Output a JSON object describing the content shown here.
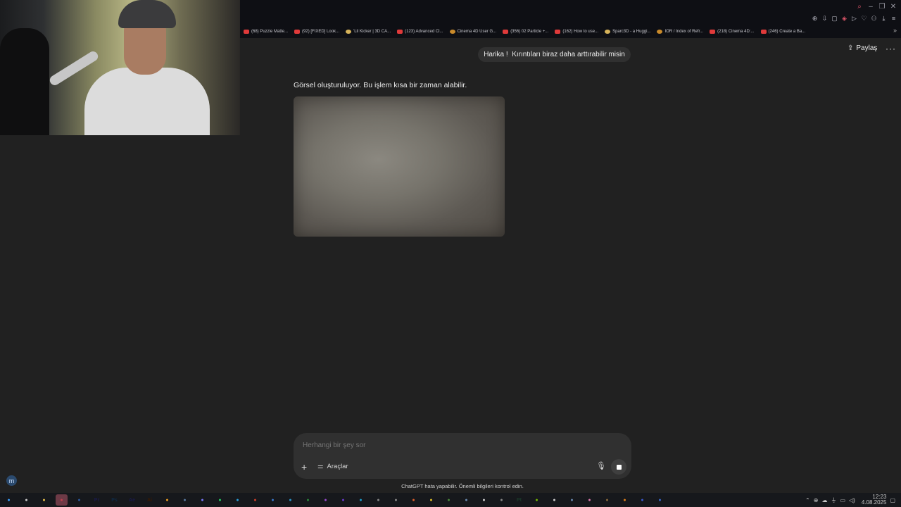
{
  "bookmarks": [
    {
      "label": "(68) Puzzle Matte...",
      "icon": "youtube-icon"
    },
    {
      "label": "(92) [FIXED] Look...",
      "icon": "youtube-icon"
    },
    {
      "label": "'Lil Kicker | 3D CA...",
      "icon": "cap-icon"
    },
    {
      "label": "(123) Advanced Cl...",
      "icon": "youtube-icon"
    },
    {
      "label": "Cinema 4D User G...",
      "icon": "gmail-icon"
    },
    {
      "label": "(356) 02 Particle +...",
      "icon": "youtube-icon"
    },
    {
      "label": "(162) How to use...",
      "icon": "youtube-icon"
    },
    {
      "label": "Sparc3D - a Huggi...",
      "icon": "huggingface-icon"
    },
    {
      "label": "IOR / Index of Refr...",
      "icon": "shield-icon"
    },
    {
      "label": "(218) Cinema 4D:...",
      "icon": "youtube-icon"
    },
    {
      "label": "(246) Create a Ba...",
      "icon": "youtube-icon"
    }
  ],
  "header": {
    "share_label": "Paylaş",
    "more_label": "···"
  },
  "conversation": {
    "user_message": "Harika !  Kırıntıları biraz daha arttırabilir misin",
    "assistant_status": "Görsel oluşturuluyor. Bu işlem kısa bir zaman alabilir."
  },
  "composer": {
    "placeholder": "Herhangi bir şey sor",
    "tools_label": "Araçlar"
  },
  "disclaimer": "ChatGPT hata yapabilir. Önemli bilgileri kontrol edin.",
  "avatar_letter": "m",
  "taskbar": {
    "apps": [
      {
        "label": "",
        "icon": "windows-start-icon",
        "color": "#3aa0ff"
      },
      {
        "label": "",
        "icon": "task-view-icon",
        "color": "#cfcfcf"
      },
      {
        "label": "",
        "icon": "file-explorer-icon",
        "color": "#e8c04a"
      },
      {
        "label": "",
        "icon": "active-app-icon",
        "color": "#c0404d",
        "active": true
      },
      {
        "label": "",
        "icon": "cinema4d-icon",
        "color": "#2c5aa0"
      },
      {
        "label": "Pr",
        "icon": "premiere-icon",
        "color": "#1a1a4a"
      },
      {
        "label": "Ps",
        "icon": "photoshop-icon",
        "color": "#0f2a45"
      },
      {
        "label": "Ae",
        "icon": "aftereffects-icon",
        "color": "#1a1a4a"
      },
      {
        "label": "Ai",
        "icon": "illustrator-icon",
        "color": "#3a1a00"
      },
      {
        "label": "",
        "icon": "search-app-icon",
        "color": "#f0a020"
      },
      {
        "label": "",
        "icon": "cloud-app-icon",
        "color": "#5a7aa0"
      },
      {
        "label": "",
        "icon": "circle-app-icon",
        "color": "#7a7aff"
      },
      {
        "label": "",
        "icon": "whatsapp-icon",
        "color": "#25d366"
      },
      {
        "label": "",
        "icon": "telegram-icon",
        "color": "#2aa3df"
      },
      {
        "label": "",
        "icon": "redshift-icon",
        "color": "#d0402a"
      },
      {
        "label": "",
        "icon": "window-app-icon",
        "color": "#3a7ad0"
      },
      {
        "label": "",
        "icon": "ring-app-icon",
        "color": "#2a9ad0"
      },
      {
        "label": "",
        "icon": "chrome-icon",
        "color": "#2a8a3a"
      },
      {
        "label": "",
        "icon": "purple-app-icon",
        "color": "#9a4ad0"
      },
      {
        "label": "",
        "icon": "brave-icon",
        "color": "#6a3ad0"
      },
      {
        "label": "",
        "icon": "edge-icon",
        "color": "#1aa0d0"
      },
      {
        "label": "",
        "icon": "openai-icon",
        "color": "#8a8a8a"
      },
      {
        "label": "",
        "icon": "gear-app-icon",
        "color": "#8a8a8a"
      },
      {
        "label": "",
        "icon": "html-app-icon",
        "color": "#e0602a"
      },
      {
        "label": "",
        "icon": "notes-app-icon",
        "color": "#e0c02a"
      },
      {
        "label": "",
        "icon": "game-app-icon",
        "color": "#4a8a3a"
      },
      {
        "label": "",
        "icon": "globe-app-icon",
        "color": "#6a8ab0"
      },
      {
        "label": "",
        "icon": "chatgpt-app-icon",
        "color": "#cfcfcf"
      },
      {
        "label": "",
        "icon": "calendar-app-icon",
        "color": "#8a8a8a"
      },
      {
        "label": "Pt",
        "icon": "painter-icon",
        "color": "#1a3a2a"
      },
      {
        "label": "",
        "icon": "nvidia-icon",
        "color": "#76b900"
      },
      {
        "label": "",
        "icon": "x-icon",
        "color": "#cfcfcf"
      },
      {
        "label": "",
        "icon": "folder-app-icon",
        "color": "#6a8ab0"
      },
      {
        "label": "",
        "icon": "pink-app-icon",
        "color": "#e07ab0"
      },
      {
        "label": "",
        "icon": "dark-app-icon",
        "color": "#8a6a3a"
      },
      {
        "label": "",
        "icon": "blender-icon",
        "color": "#e0801a"
      },
      {
        "label": "",
        "icon": "c-app-icon",
        "color": "#3a5ad0"
      },
      {
        "label": "",
        "icon": "blue-square-icon",
        "color": "#3a6ad0"
      }
    ],
    "time": "12:23",
    "date": "4.08.2025"
  }
}
